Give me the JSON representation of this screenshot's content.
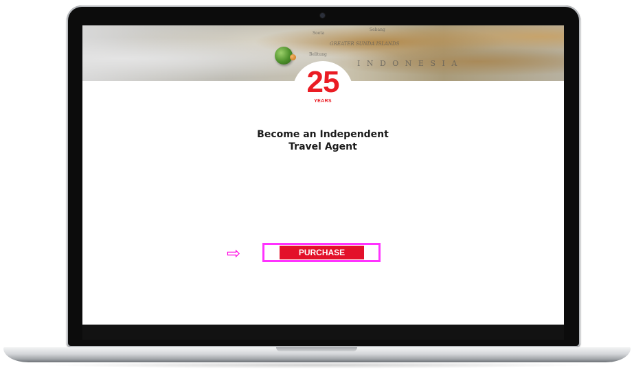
{
  "banner": {
    "map_labels": [
      "Soeta",
      "Sebang",
      "GREATER SUNDA ISLANDS",
      "Belitung",
      "I N D O N E S I A"
    ]
  },
  "badge": {
    "number": "25",
    "label": "YEARS"
  },
  "headline": {
    "line1": "Become an Independent",
    "line2": "Travel Agent"
  },
  "cta": {
    "arrow": "⇨",
    "button_label": "PURCHASE"
  },
  "colors": {
    "accent_red": "#ea1c24",
    "button_red": "#e3112a",
    "highlight_magenta": "#ff33ff",
    "arrow_magenta": "#ff00e0"
  },
  "icons": [
    "webcam-icon",
    "map-pin-icon",
    "arrow-right-icon"
  ]
}
